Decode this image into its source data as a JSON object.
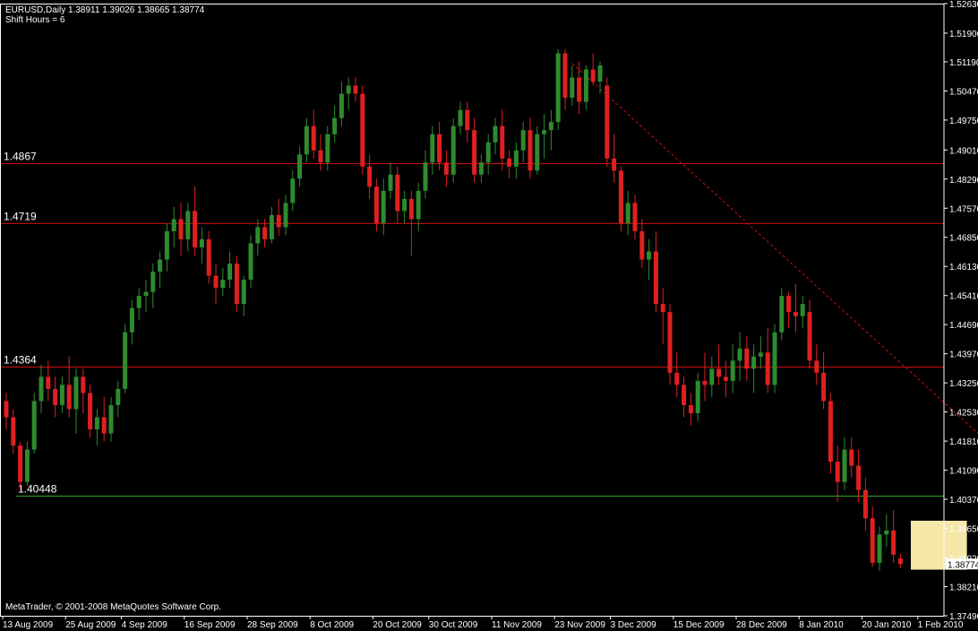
{
  "header": {
    "line1": "EURUSD,Daily  1.38911 1.39026 1.38665 1.38774",
    "line2": "Shift Hours = 6"
  },
  "footer": {
    "copyright": "MetaTrader, © 2001-2008 MetaQuotes Software Corp."
  },
  "current_price_label": "1.38774",
  "colors": {
    "background": "#000000",
    "bull": "#2e8b2e",
    "bear": "#e02020",
    "resistance": "#d01010",
    "support": "#2fa02f",
    "trendline": "#d01010",
    "highlight": "#f5e7a8",
    "axis": "#ffffff"
  },
  "chart_data": {
    "type": "candlestick",
    "symbol": "EURUSD",
    "timeframe": "Daily",
    "ylim": [
      1.3749,
      1.5263
    ],
    "y_ticks": [
      "1.52630",
      "1.51900",
      "1.51190",
      "1.50470",
      "1.49750",
      "1.49010",
      "1.48290",
      "1.47570",
      "1.46850",
      "1.46130",
      "1.45410",
      "1.44690",
      "1.43970",
      "1.43250",
      "1.42530",
      "1.41810",
      "1.41090",
      "1.40370",
      "1.39650",
      "1.38920",
      "1.38210",
      "1.37490"
    ],
    "x_ticks": [
      "13 Aug 2009",
      "25 Aug 2009",
      "4 Sep 2009",
      "16 Sep 2009",
      "28 Sep 2009",
      "8 Oct 2009",
      "20 Oct 2009",
      "30 Oct 2009",
      "11 Nov 2009",
      "23 Nov 2009",
      "3 Dec 2009",
      "15 Dec 2009",
      "28 Dec 2009",
      "8 Jan 2010",
      "20 Jan 2010",
      "1 Feb 2010"
    ],
    "x_tick_bar_index": [
      0,
      9,
      17,
      26,
      35,
      44,
      53,
      61,
      70,
      79,
      87,
      96,
      105,
      114,
      123,
      131
    ],
    "horizontal_lines": [
      {
        "label": "1.4867",
        "value": 1.4867,
        "kind": "resistance"
      },
      {
        "label": "1.4719",
        "value": 1.4719,
        "kind": "resistance"
      },
      {
        "label": "1.4364",
        "value": 1.4364,
        "kind": "resistance"
      },
      {
        "label": "1.40448",
        "value": 1.40448,
        "kind": "support"
      }
    ],
    "trendline": {
      "from": {
        "bar": 81,
        "value": 1.5115
      },
      "to": {
        "bar": 141,
        "value": 1.417
      },
      "style": "dashed"
    },
    "highlight_box": {
      "from_bar": 130,
      "to_bar": 137,
      "low": 1.3863,
      "high": 1.3984
    },
    "candles": [
      [
        1.428,
        1.43,
        1.421,
        1.424
      ],
      [
        1.424,
        1.426,
        1.415,
        1.417
      ],
      [
        1.417,
        1.418,
        1.406,
        1.408
      ],
      [
        1.408,
        1.418,
        1.407,
        1.416
      ],
      [
        1.416,
        1.43,
        1.415,
        1.428
      ],
      [
        1.428,
        1.437,
        1.425,
        1.434
      ],
      [
        1.434,
        1.438,
        1.428,
        1.431
      ],
      [
        1.431,
        1.434,
        1.424,
        1.427
      ],
      [
        1.427,
        1.434,
        1.425,
        1.432
      ],
      [
        1.432,
        1.439,
        1.424,
        1.426
      ],
      [
        1.426,
        1.436,
        1.42,
        1.434
      ],
      [
        1.434,
        1.436,
        1.425,
        1.43
      ],
      [
        1.43,
        1.432,
        1.419,
        1.421
      ],
      [
        1.421,
        1.426,
        1.417,
        1.424
      ],
      [
        1.424,
        1.429,
        1.418,
        1.42
      ],
      [
        1.42,
        1.429,
        1.418,
        1.427
      ],
      [
        1.427,
        1.433,
        1.424,
        1.431
      ],
      [
        1.431,
        1.447,
        1.43,
        1.445
      ],
      [
        1.445,
        1.453,
        1.442,
        1.451
      ],
      [
        1.451,
        1.456,
        1.448,
        1.454
      ],
      [
        1.454,
        1.458,
        1.45,
        1.455
      ],
      [
        1.455,
        1.462,
        1.451,
        1.46
      ],
      [
        1.46,
        1.465,
        1.456,
        1.463
      ],
      [
        1.463,
        1.472,
        1.46,
        1.47
      ],
      [
        1.47,
        1.476,
        1.466,
        1.473
      ],
      [
        1.473,
        1.477,
        1.464,
        1.468
      ],
      [
        1.468,
        1.477,
        1.465,
        1.475
      ],
      [
        1.475,
        1.481,
        1.464,
        1.466
      ],
      [
        1.466,
        1.471,
        1.462,
        1.468
      ],
      [
        1.468,
        1.47,
        1.457,
        1.459
      ],
      [
        1.459,
        1.462,
        1.452,
        1.456
      ],
      [
        1.456,
        1.461,
        1.454,
        1.458
      ],
      [
        1.458,
        1.465,
        1.456,
        1.462
      ],
      [
        1.462,
        1.464,
        1.45,
        1.452
      ],
      [
        1.452,
        1.459,
        1.449,
        1.458
      ],
      [
        1.458,
        1.469,
        1.456,
        1.467
      ],
      [
        1.467,
        1.473,
        1.464,
        1.471
      ],
      [
        1.471,
        1.473,
        1.466,
        1.468
      ],
      [
        1.468,
        1.476,
        1.467,
        1.474
      ],
      [
        1.474,
        1.478,
        1.469,
        1.471
      ],
      [
        1.471,
        1.479,
        1.469,
        1.477
      ],
      [
        1.477,
        1.485,
        1.475,
        1.483
      ],
      [
        1.483,
        1.491,
        1.481,
        1.489
      ],
      [
        1.489,
        1.498,
        1.487,
        1.496
      ],
      [
        1.496,
        1.5,
        1.488,
        1.49
      ],
      [
        1.49,
        1.494,
        1.485,
        1.487
      ],
      [
        1.487,
        1.496,
        1.485,
        1.494
      ],
      [
        1.494,
        1.501,
        1.492,
        1.498
      ],
      [
        1.498,
        1.507,
        1.496,
        1.504
      ],
      [
        1.504,
        1.508,
        1.5,
        1.506
      ],
      [
        1.506,
        1.508,
        1.502,
        1.504
      ],
      [
        1.504,
        1.506,
        1.484,
        1.486
      ],
      [
        1.486,
        1.489,
        1.478,
        1.481
      ],
      [
        1.481,
        1.483,
        1.47,
        1.472
      ],
      [
        1.472,
        1.483,
        1.469,
        1.48
      ],
      [
        1.48,
        1.487,
        1.478,
        1.484
      ],
      [
        1.484,
        1.486,
        1.472,
        1.475
      ],
      [
        1.475,
        1.48,
        1.472,
        1.478
      ],
      [
        1.478,
        1.48,
        1.464,
        1.473
      ],
      [
        1.473,
        1.482,
        1.47,
        1.48
      ],
      [
        1.48,
        1.49,
        1.478,
        1.487
      ],
      [
        1.487,
        1.496,
        1.484,
        1.494
      ],
      [
        1.494,
        1.497,
        1.485,
        1.487
      ],
      [
        1.487,
        1.49,
        1.481,
        1.484
      ],
      [
        1.484,
        1.498,
        1.482,
        1.496
      ],
      [
        1.496,
        1.502,
        1.494,
        1.5
      ],
      [
        1.5,
        1.502,
        1.492,
        1.495
      ],
      [
        1.495,
        1.498,
        1.482,
        1.484
      ],
      [
        1.484,
        1.489,
        1.482,
        1.487
      ],
      [
        1.487,
        1.494,
        1.484,
        1.492
      ],
      [
        1.492,
        1.498,
        1.489,
        1.496
      ],
      [
        1.496,
        1.5,
        1.485,
        1.488
      ],
      [
        1.488,
        1.49,
        1.483,
        1.486
      ],
      [
        1.486,
        1.492,
        1.483,
        1.49
      ],
      [
        1.49,
        1.497,
        1.487,
        1.495
      ],
      [
        1.495,
        1.498,
        1.483,
        1.485
      ],
      [
        1.485,
        1.496,
        1.484,
        1.494
      ],
      [
        1.494,
        1.499,
        1.488,
        1.495
      ],
      [
        1.495,
        1.5,
        1.49,
        1.497
      ],
      [
        1.497,
        1.515,
        1.495,
        1.514
      ],
      [
        1.514,
        1.515,
        1.5,
        1.503
      ],
      [
        1.503,
        1.511,
        1.501,
        1.508
      ],
      [
        1.508,
        1.512,
        1.499,
        1.502
      ],
      [
        1.502,
        1.511,
        1.5,
        1.51
      ],
      [
        1.51,
        1.514,
        1.506,
        1.507
      ],
      [
        1.507,
        1.512,
        1.504,
        1.511
      ],
      [
        1.506,
        1.508,
        1.486,
        1.488
      ],
      [
        1.488,
        1.494,
        1.482,
        1.485
      ],
      [
        1.485,
        1.486,
        1.47,
        1.472
      ],
      [
        1.472,
        1.48,
        1.469,
        1.477
      ],
      [
        1.477,
        1.479,
        1.468,
        1.47
      ],
      [
        1.47,
        1.473,
        1.461,
        1.463
      ],
      [
        1.463,
        1.468,
        1.458,
        1.465
      ],
      [
        1.465,
        1.47,
        1.45,
        1.452
      ],
      [
        1.452,
        1.456,
        1.442,
        1.45
      ],
      [
        1.45,
        1.452,
        1.432,
        1.435
      ],
      [
        1.435,
        1.44,
        1.429,
        1.432
      ],
      [
        1.432,
        1.434,
        1.424,
        1.427
      ],
      [
        1.427,
        1.43,
        1.422,
        1.425
      ],
      [
        1.425,
        1.435,
        1.423,
        1.433
      ],
      [
        1.433,
        1.44,
        1.428,
        1.432
      ],
      [
        1.432,
        1.439,
        1.429,
        1.436
      ],
      [
        1.436,
        1.442,
        1.432,
        1.434
      ],
      [
        1.434,
        1.438,
        1.429,
        1.433
      ],
      [
        1.433,
        1.442,
        1.43,
        1.438
      ],
      [
        1.438,
        1.445,
        1.433,
        1.441
      ],
      [
        1.441,
        1.444,
        1.433,
        1.436
      ],
      [
        1.436,
        1.442,
        1.43,
        1.439
      ],
      [
        1.439,
        1.444,
        1.436,
        1.44
      ],
      [
        1.44,
        1.446,
        1.43,
        1.432
      ],
      [
        1.432,
        1.447,
        1.43,
        1.445
      ],
      [
        1.445,
        1.456,
        1.443,
        1.454
      ],
      [
        1.454,
        1.455,
        1.446,
        1.45
      ],
      [
        1.45,
        1.457,
        1.445,
        1.449
      ],
      [
        1.449,
        1.454,
        1.446,
        1.452
      ],
      [
        1.45,
        1.453,
        1.436,
        1.438
      ],
      [
        1.438,
        1.442,
        1.432,
        1.435
      ],
      [
        1.435,
        1.44,
        1.426,
        1.428
      ],
      [
        1.428,
        1.43,
        1.41,
        1.413
      ],
      [
        1.413,
        1.417,
        1.403,
        1.408
      ],
      [
        1.408,
        1.419,
        1.406,
        1.416
      ],
      [
        1.416,
        1.419,
        1.409,
        1.412
      ],
      [
        1.412,
        1.416,
        1.403,
        1.406
      ],
      [
        1.406,
        1.409,
        1.396,
        1.399
      ],
      [
        1.399,
        1.402,
        1.387,
        1.388
      ],
      [
        1.388,
        1.397,
        1.386,
        1.395
      ],
      [
        1.395,
        1.4,
        1.392,
        1.396
      ],
      [
        1.396,
        1.401,
        1.388,
        1.39
      ],
      [
        1.3891,
        1.3903,
        1.3867,
        1.3877
      ]
    ]
  }
}
